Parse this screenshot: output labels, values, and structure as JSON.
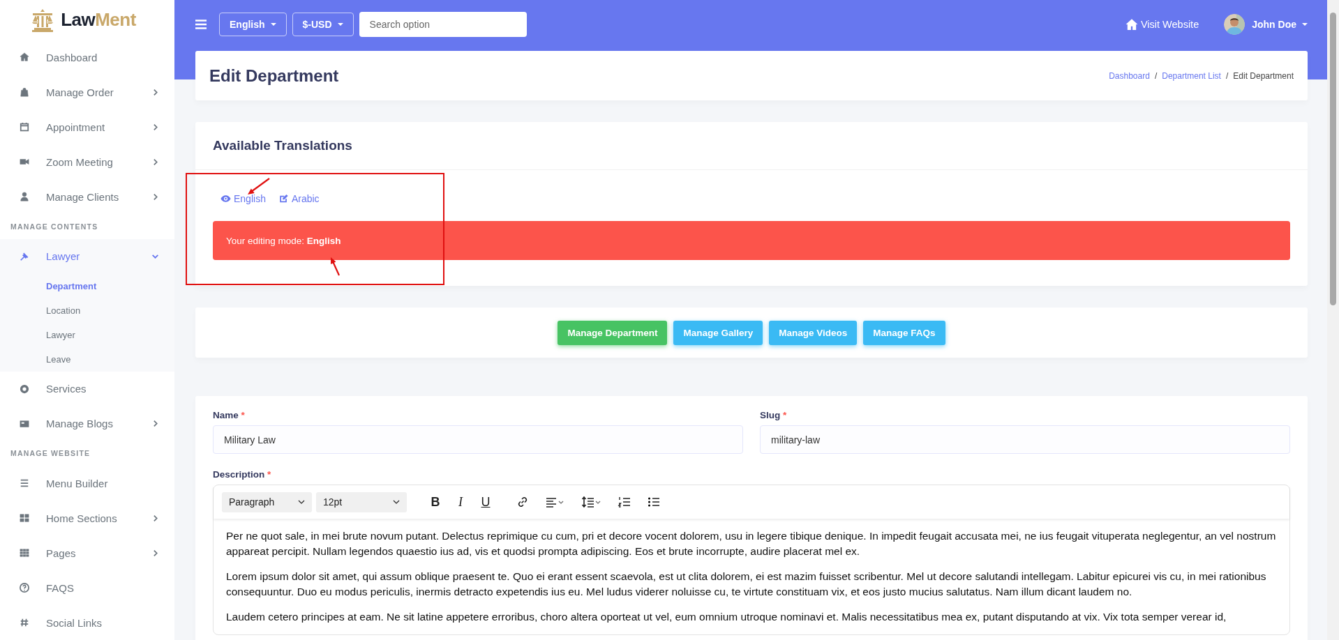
{
  "logo_parts": [
    "Law",
    "Ment"
  ],
  "sidebar": {
    "items": [
      {
        "kind": "link",
        "label": "Dashboard",
        "expandable": false,
        "selected": false
      },
      {
        "kind": "link",
        "label": "Manage Order",
        "expandable": true,
        "selected": false
      },
      {
        "kind": "link",
        "label": "Appointment",
        "expandable": true,
        "selected": false
      },
      {
        "kind": "link",
        "label": "Zoom Meeting",
        "expandable": true,
        "selected": false
      },
      {
        "kind": "link",
        "label": "Manage Clients",
        "expandable": true,
        "selected": false
      },
      {
        "kind": "heading",
        "label": "MANAGE CONTENTS"
      },
      {
        "kind": "link",
        "label": "Lawyer",
        "expandable": true,
        "expanded": true,
        "selected": true,
        "children": [
          {
            "label": "Department",
            "selected": true
          },
          {
            "label": "Location",
            "selected": false
          },
          {
            "label": "Lawyer",
            "selected": false
          },
          {
            "label": "Leave",
            "selected": false
          }
        ]
      },
      {
        "kind": "link",
        "label": "Services",
        "expandable": false,
        "selected": false
      },
      {
        "kind": "link",
        "label": "Manage Blogs",
        "expandable": true,
        "selected": false
      },
      {
        "kind": "heading",
        "label": "MANAGE WEBSITE"
      },
      {
        "kind": "link",
        "label": "Menu Builder",
        "expandable": false,
        "selected": false
      },
      {
        "kind": "link",
        "label": "Home Sections",
        "expandable": true,
        "selected": false
      },
      {
        "kind": "link",
        "label": "Pages",
        "expandable": true,
        "selected": false
      },
      {
        "kind": "link",
        "label": "FAQS",
        "expandable": false,
        "selected": false
      },
      {
        "kind": "link",
        "label": "Social Links",
        "expandable": false,
        "selected": false
      }
    ]
  },
  "topbar": {
    "language": "English",
    "currency": "$-USD",
    "search": {
      "placeholder": "Search option"
    },
    "visit_website": "Visit Website",
    "user": "John Doe"
  },
  "page_header": {
    "title": "Edit Department",
    "breadcrumb": [
      {
        "label": "Dashboard",
        "link": true
      },
      {
        "separator": "/",
        "label": "Department List",
        "link": true
      },
      {
        "separator": "/",
        "label": "Edit Department",
        "link": false
      }
    ]
  },
  "translations": {
    "title": "Available Translations",
    "languages": [
      {
        "label": "English",
        "kind": "view"
      },
      {
        "label": "Arabic",
        "kind": "edit"
      }
    ],
    "alert": "Your editing mode: **English**"
  },
  "actions": [
    {
      "label": "Manage Department",
      "color": "#47c363"
    },
    {
      "label": "Manage Gallery",
      "color": "#3abaf4"
    },
    {
      "label": "Manage Videos",
      "color": "#3abaf4"
    },
    {
      "label": "Manage FAQs",
      "color": "#3abaf4"
    }
  ],
  "form": {
    "fields": [
      {
        "label": "Name",
        "required_mark": "*",
        "value": "Military Law"
      },
      {
        "label": "Slug",
        "required_mark": "*",
        "value": "military-law"
      }
    ],
    "description": {
      "label": "Description",
      "required_mark": "*",
      "toolbar": {
        "block_format": "Paragraph",
        "font_size": "12pt",
        "format_buttons": [
          {
            "label": "B",
            "kind": "bold"
          },
          {
            "label": "I",
            "kind": "italic"
          },
          {
            "label": "U",
            "kind": "underline"
          }
        ]
      },
      "paragraphs": [
        "Per ne quot sale, in mei brute novum putant. Delectus reprimique cu cum, pri et decore vocent dolorem, usu in legere tibique denique. In impedit feugait accusata mei, ne ius feugait vituperata neglegentur, an vel nostrum appareat percipit. Nullam legendos quaestio ius ad, vis et quodsi prompta adipiscing. Eos et brute incorrupte, audire placerat mel ex.",
        "Lorem ipsum dolor sit amet, qui assum oblique praesent te. Quo ei erant essent scaevola, est ut clita dolorem, ei est mazim fuisset scribentur. Mel ut decore salutandi intellegam. Labitur epicurei vis cu, in mei rationibus consequuntur. Duo eu modus periculis, inermis detracto expetendis ius eu. Mel ludus viderer noluisse cu, te virtute constituam vix, et eos justo mucius salutatus. Nam illum dicant laudem no.",
        "Laudem cetero principes at eam. Ne sit latine appetere erroribus, choro altera oporteat ut vel, eum omnium utroque nominavi et. Malis necessitatibus mea ex, putant disputando at vix. Vix tota semper verear id,"
      ]
    }
  }
}
